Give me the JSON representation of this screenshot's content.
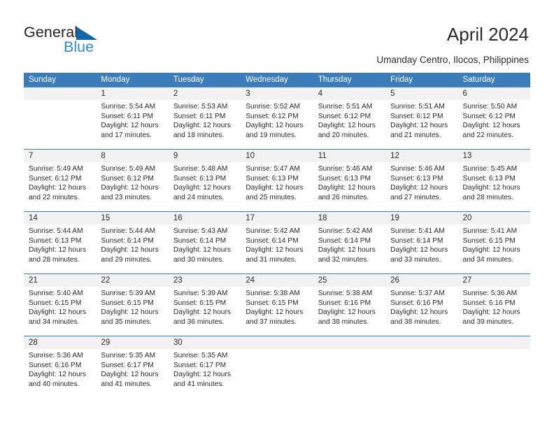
{
  "brand": {
    "name_part1": "General",
    "name_part2": "Blue",
    "accent_color": "#2e8bd4",
    "triangle_color": "#1464aa",
    "logo_icon": "triangle-logo-icon"
  },
  "header": {
    "title": "April 2024",
    "subtitle": "Umanday Centro, Ilocos, Philippines"
  },
  "calendar": {
    "header_bg": "#3b7cba",
    "header_text_color": "#ffffff",
    "daynum_band_bg": "#f2f2f2",
    "weekdays": [
      "Sunday",
      "Monday",
      "Tuesday",
      "Wednesday",
      "Thursday",
      "Friday",
      "Saturday"
    ],
    "weeks": [
      {
        "numbers": [
          "",
          "1",
          "2",
          "3",
          "4",
          "5",
          "6"
        ],
        "cells": [
          {
            "empty": true
          },
          {
            "sunrise": "Sunrise: 5:54 AM",
            "sunset": "Sunset: 6:11 PM",
            "daylight_line1": "Daylight: 12 hours",
            "daylight_line2": "and 17 minutes."
          },
          {
            "sunrise": "Sunrise: 5:53 AM",
            "sunset": "Sunset: 6:11 PM",
            "daylight_line1": "Daylight: 12 hours",
            "daylight_line2": "and 18 minutes."
          },
          {
            "sunrise": "Sunrise: 5:52 AM",
            "sunset": "Sunset: 6:12 PM",
            "daylight_line1": "Daylight: 12 hours",
            "daylight_line2": "and 19 minutes."
          },
          {
            "sunrise": "Sunrise: 5:51 AM",
            "sunset": "Sunset: 6:12 PM",
            "daylight_line1": "Daylight: 12 hours",
            "daylight_line2": "and 20 minutes."
          },
          {
            "sunrise": "Sunrise: 5:51 AM",
            "sunset": "Sunset: 6:12 PM",
            "daylight_line1": "Daylight: 12 hours",
            "daylight_line2": "and 21 minutes."
          },
          {
            "sunrise": "Sunrise: 5:50 AM",
            "sunset": "Sunset: 6:12 PM",
            "daylight_line1": "Daylight: 12 hours",
            "daylight_line2": "and 22 minutes."
          }
        ]
      },
      {
        "numbers": [
          "7",
          "8",
          "9",
          "10",
          "11",
          "12",
          "13"
        ],
        "cells": [
          {
            "sunrise": "Sunrise: 5:49 AM",
            "sunset": "Sunset: 6:12 PM",
            "daylight_line1": "Daylight: 12 hours",
            "daylight_line2": "and 22 minutes."
          },
          {
            "sunrise": "Sunrise: 5:49 AM",
            "sunset": "Sunset: 6:12 PM",
            "daylight_line1": "Daylight: 12 hours",
            "daylight_line2": "and 23 minutes."
          },
          {
            "sunrise": "Sunrise: 5:48 AM",
            "sunset": "Sunset: 6:13 PM",
            "daylight_line1": "Daylight: 12 hours",
            "daylight_line2": "and 24 minutes."
          },
          {
            "sunrise": "Sunrise: 5:47 AM",
            "sunset": "Sunset: 6:13 PM",
            "daylight_line1": "Daylight: 12 hours",
            "daylight_line2": "and 25 minutes."
          },
          {
            "sunrise": "Sunrise: 5:46 AM",
            "sunset": "Sunset: 6:13 PM",
            "daylight_line1": "Daylight: 12 hours",
            "daylight_line2": "and 26 minutes."
          },
          {
            "sunrise": "Sunrise: 5:46 AM",
            "sunset": "Sunset: 6:13 PM",
            "daylight_line1": "Daylight: 12 hours",
            "daylight_line2": "and 27 minutes."
          },
          {
            "sunrise": "Sunrise: 5:45 AM",
            "sunset": "Sunset: 6:13 PM",
            "daylight_line1": "Daylight: 12 hours",
            "daylight_line2": "and 28 minutes."
          }
        ]
      },
      {
        "numbers": [
          "14",
          "15",
          "16",
          "17",
          "18",
          "19",
          "20"
        ],
        "cells": [
          {
            "sunrise": "Sunrise: 5:44 AM",
            "sunset": "Sunset: 6:13 PM",
            "daylight_line1": "Daylight: 12 hours",
            "daylight_line2": "and 28 minutes."
          },
          {
            "sunrise": "Sunrise: 5:44 AM",
            "sunset": "Sunset: 6:14 PM",
            "daylight_line1": "Daylight: 12 hours",
            "daylight_line2": "and 29 minutes."
          },
          {
            "sunrise": "Sunrise: 5:43 AM",
            "sunset": "Sunset: 6:14 PM",
            "daylight_line1": "Daylight: 12 hours",
            "daylight_line2": "and 30 minutes."
          },
          {
            "sunrise": "Sunrise: 5:42 AM",
            "sunset": "Sunset: 6:14 PM",
            "daylight_line1": "Daylight: 12 hours",
            "daylight_line2": "and 31 minutes."
          },
          {
            "sunrise": "Sunrise: 5:42 AM",
            "sunset": "Sunset: 6:14 PM",
            "daylight_line1": "Daylight: 12 hours",
            "daylight_line2": "and 32 minutes."
          },
          {
            "sunrise": "Sunrise: 5:41 AM",
            "sunset": "Sunset: 6:14 PM",
            "daylight_line1": "Daylight: 12 hours",
            "daylight_line2": "and 33 minutes."
          },
          {
            "sunrise": "Sunrise: 5:41 AM",
            "sunset": "Sunset: 6:15 PM",
            "daylight_line1": "Daylight: 12 hours",
            "daylight_line2": "and 34 minutes."
          }
        ]
      },
      {
        "numbers": [
          "21",
          "22",
          "23",
          "24",
          "25",
          "26",
          "27"
        ],
        "cells": [
          {
            "sunrise": "Sunrise: 5:40 AM",
            "sunset": "Sunset: 6:15 PM",
            "daylight_line1": "Daylight: 12 hours",
            "daylight_line2": "and 34 minutes."
          },
          {
            "sunrise": "Sunrise: 5:39 AM",
            "sunset": "Sunset: 6:15 PM",
            "daylight_line1": "Daylight: 12 hours",
            "daylight_line2": "and 35 minutes."
          },
          {
            "sunrise": "Sunrise: 5:39 AM",
            "sunset": "Sunset: 6:15 PM",
            "daylight_line1": "Daylight: 12 hours",
            "daylight_line2": "and 36 minutes."
          },
          {
            "sunrise": "Sunrise: 5:38 AM",
            "sunset": "Sunset: 6:15 PM",
            "daylight_line1": "Daylight: 12 hours",
            "daylight_line2": "and 37 minutes."
          },
          {
            "sunrise": "Sunrise: 5:38 AM",
            "sunset": "Sunset: 6:16 PM",
            "daylight_line1": "Daylight: 12 hours",
            "daylight_line2": "and 38 minutes."
          },
          {
            "sunrise": "Sunrise: 5:37 AM",
            "sunset": "Sunset: 6:16 PM",
            "daylight_line1": "Daylight: 12 hours",
            "daylight_line2": "and 38 minutes."
          },
          {
            "sunrise": "Sunrise: 5:36 AM",
            "sunset": "Sunset: 6:16 PM",
            "daylight_line1": "Daylight: 12 hours",
            "daylight_line2": "and 39 minutes."
          }
        ]
      },
      {
        "numbers": [
          "28",
          "29",
          "30",
          "",
          "",
          "",
          ""
        ],
        "cells": [
          {
            "sunrise": "Sunrise: 5:36 AM",
            "sunset": "Sunset: 6:16 PM",
            "daylight_line1": "Daylight: 12 hours",
            "daylight_line2": "and 40 minutes."
          },
          {
            "sunrise": "Sunrise: 5:35 AM",
            "sunset": "Sunset: 6:17 PM",
            "daylight_line1": "Daylight: 12 hours",
            "daylight_line2": "and 41 minutes."
          },
          {
            "sunrise": "Sunrise: 5:35 AM",
            "sunset": "Sunset: 6:17 PM",
            "daylight_line1": "Daylight: 12 hours",
            "daylight_line2": "and 41 minutes."
          },
          {
            "empty": true
          },
          {
            "empty": true
          },
          {
            "empty": true
          },
          {
            "empty": true
          }
        ]
      }
    ]
  }
}
